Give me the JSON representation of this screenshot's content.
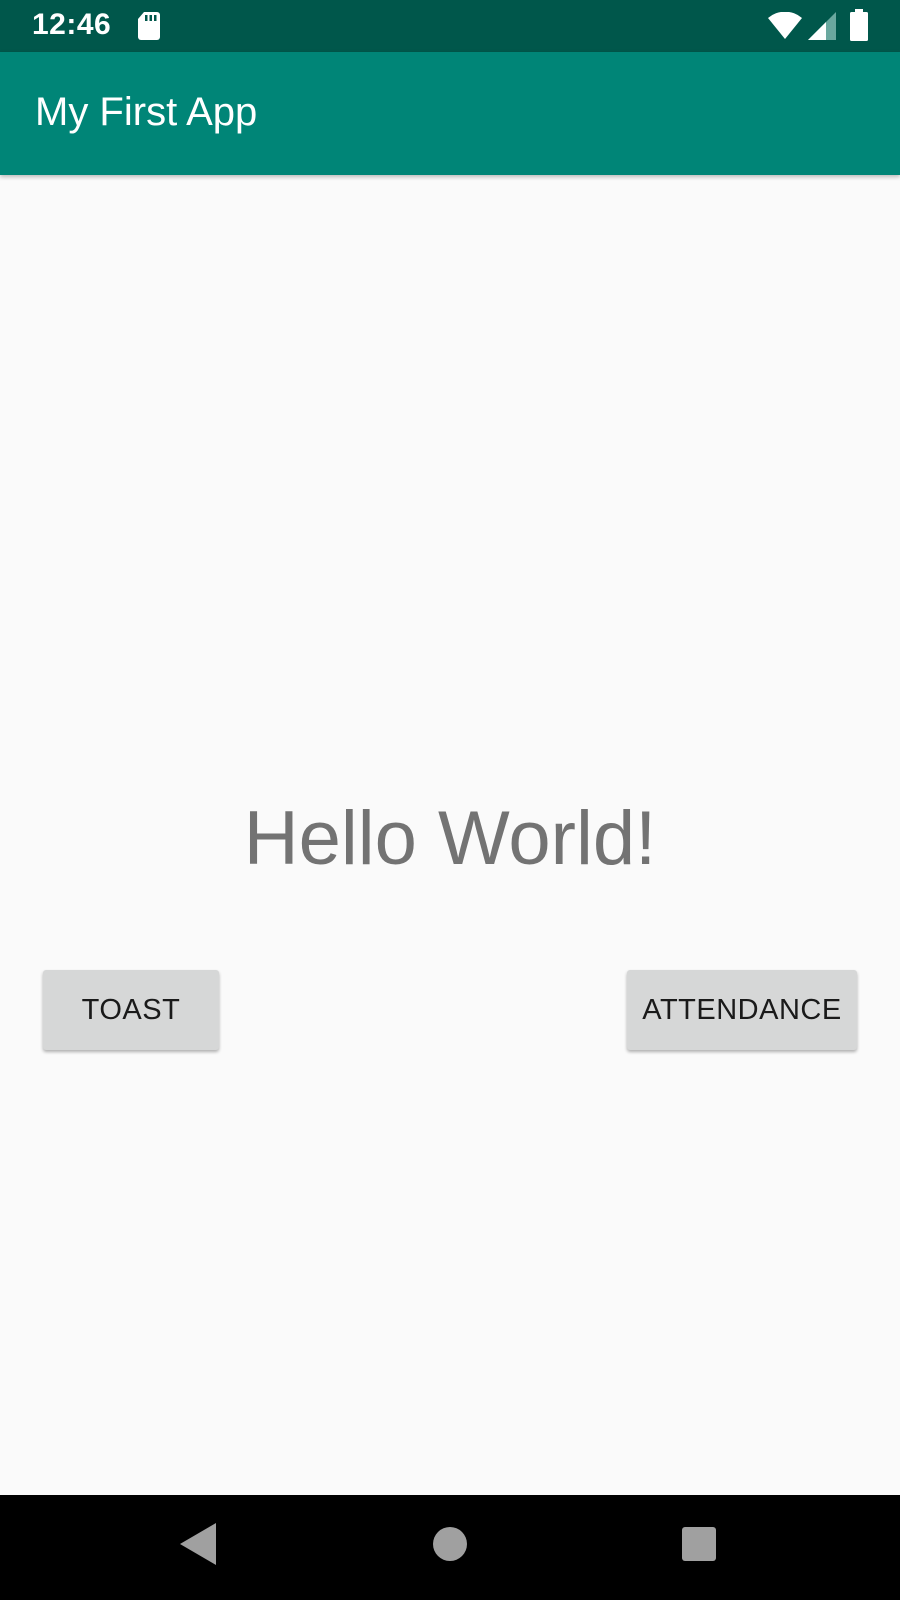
{
  "status_bar": {
    "time": "12:46",
    "icons": [
      "sd-card-icon",
      "wifi-icon",
      "signal-icon",
      "battery-icon"
    ],
    "background": "#00574b"
  },
  "app_bar": {
    "title": "My First App",
    "background": "#008577"
  },
  "main": {
    "message": "Hello World!",
    "buttons": {
      "toast_label": "TOAST",
      "attendance_label": "ATTENDANCE"
    }
  },
  "nav_bar": {
    "icons": [
      "back-icon",
      "home-icon",
      "recents-icon"
    ]
  },
  "colors": {
    "accent": "#008577",
    "accent_dark": "#00574b",
    "button_bg": "#d6d7d7",
    "text_secondary": "#737373"
  }
}
